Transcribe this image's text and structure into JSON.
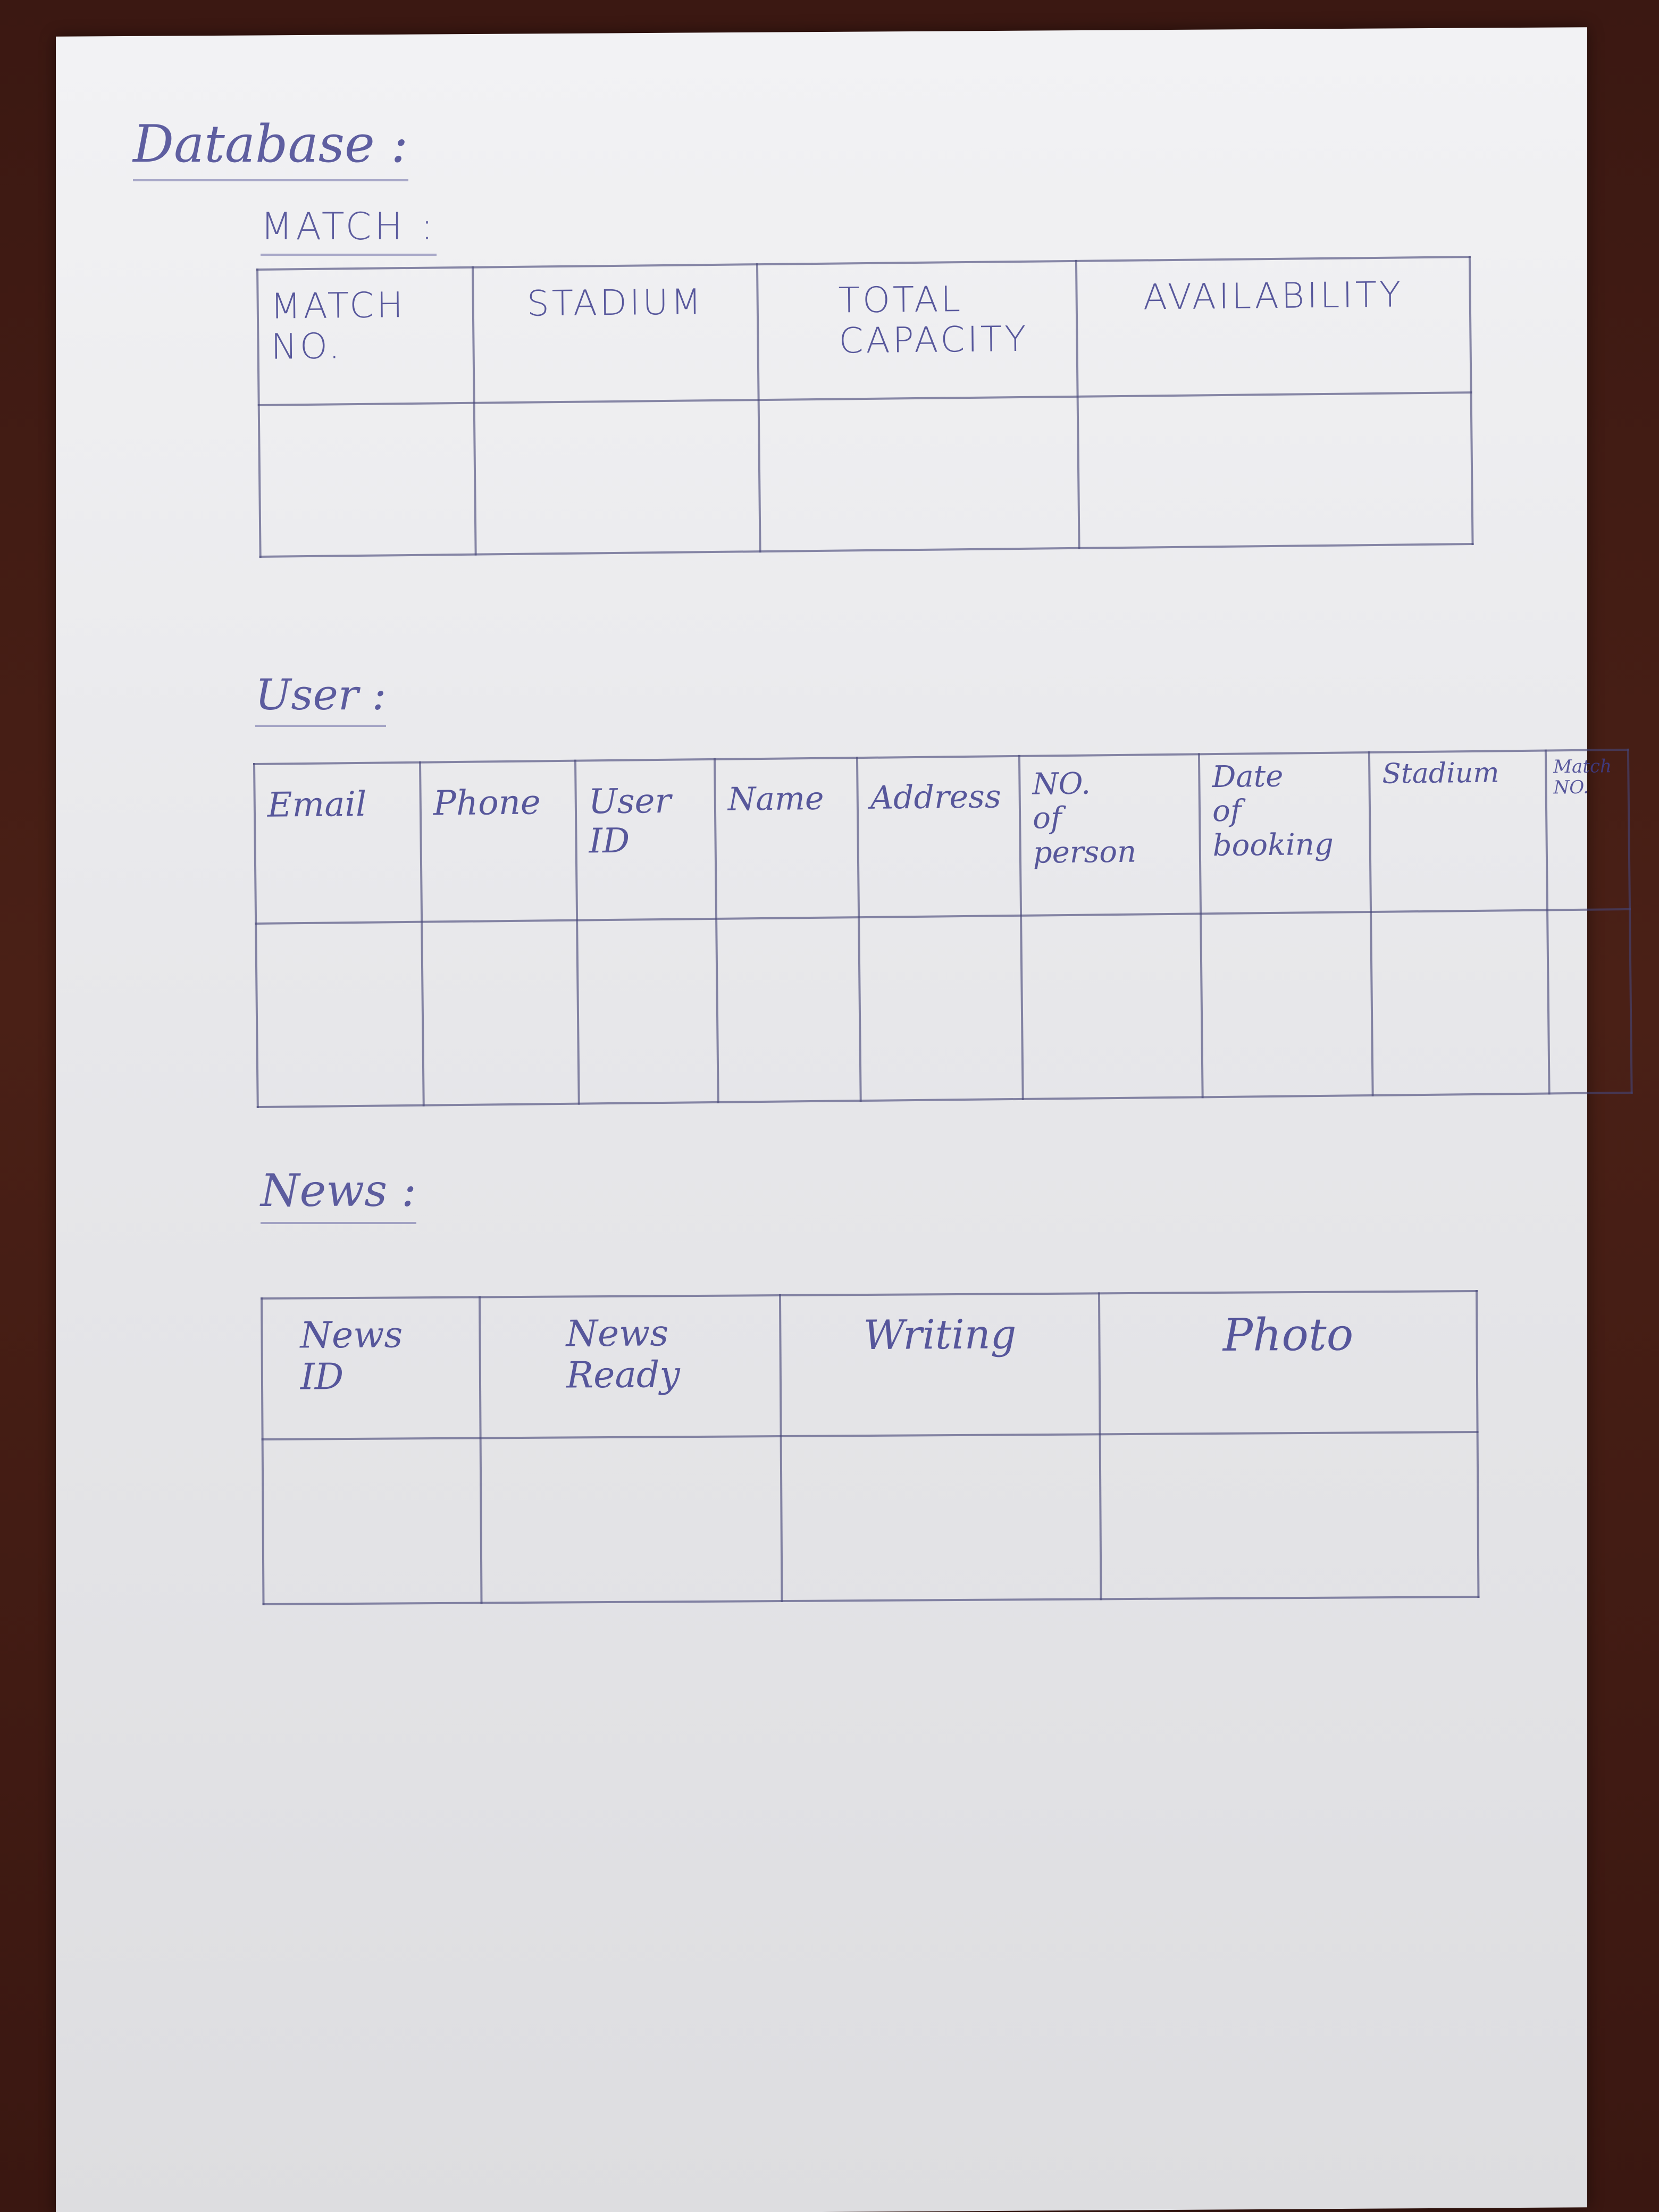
{
  "document": {
    "title": "Database :",
    "sections": {
      "match": {
        "heading": "MATCH :",
        "columns": [
          "MATCH\nNO.",
          "STADIUM",
          "TOTAL\nCAPACITY",
          "AVAILABILITY"
        ]
      },
      "user": {
        "heading": "User :",
        "columns": [
          "Email",
          "Phone",
          "User\nID",
          "Name",
          "Address",
          "NO.\nof\nperson",
          "Date\nof\nbooking",
          "Stadium",
          "Match\nNO."
        ]
      },
      "news": {
        "heading": "News :",
        "columns": [
          "News\nID",
          "News\nReady",
          "Writing",
          "Photo"
        ]
      }
    }
  }
}
